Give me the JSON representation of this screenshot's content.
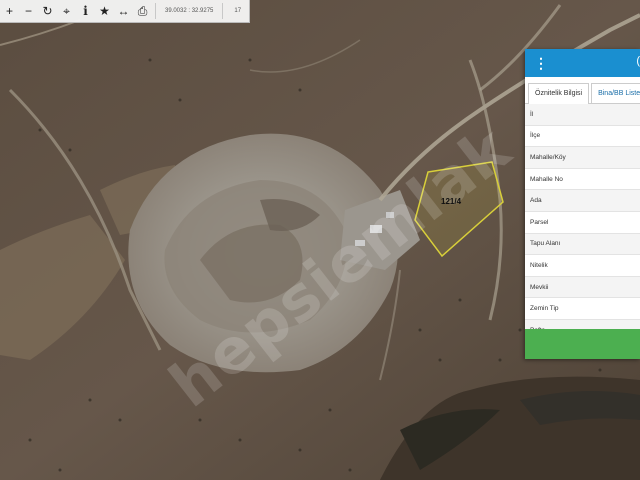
{
  "toolbar": {
    "buttons": [
      {
        "icon": "zoom-in-icon",
        "glyph": "+"
      },
      {
        "icon": "zoom-out-icon",
        "glyph": "−"
      },
      {
        "icon": "refresh-icon",
        "glyph": "↻"
      },
      {
        "icon": "locate-icon",
        "glyph": "⌖"
      },
      {
        "icon": "info-icon",
        "glyph": "i"
      },
      {
        "icon": "star-icon",
        "glyph": "★"
      },
      {
        "icon": "measure-icon",
        "glyph": "↔"
      },
      {
        "icon": "print-icon",
        "glyph": "⎙"
      }
    ],
    "coordinates": "39.0032 : 32.9275",
    "zoom_level": "17"
  },
  "map": {
    "parcel_label": "121/4",
    "watermark": "hepsiemlak",
    "parcel_outline_color": "#d8cf3a"
  },
  "panel": {
    "header_color": "#1a8fd0",
    "footer_color": "#4caf50",
    "tabs": [
      {
        "label": "Öznitelik Bilgisi",
        "active": true
      },
      {
        "label": "Bina/BB Listesi",
        "active": false
      }
    ],
    "fields": [
      "İl",
      "İlçe",
      "Mahalle/Köy",
      "Mahalle No",
      "Ada",
      "Parsel",
      "Tapu Alanı",
      "Nitelik",
      "Mevkii",
      "Zemin Tip",
      "Pafta"
    ]
  }
}
